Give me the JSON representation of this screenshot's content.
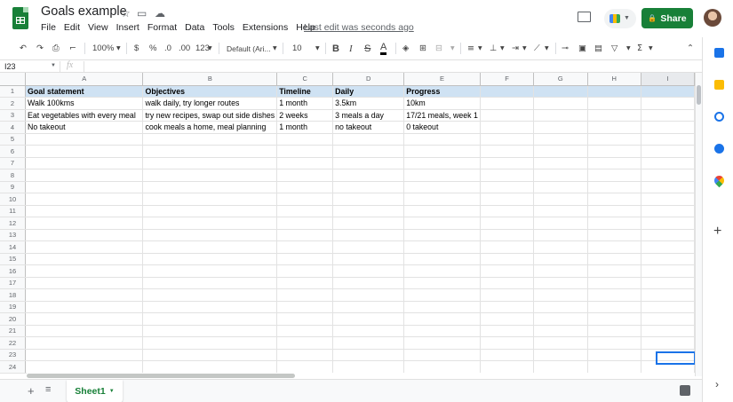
{
  "title": "Goals example",
  "menu": [
    "File",
    "Edit",
    "View",
    "Insert",
    "Format",
    "Data",
    "Tools",
    "Extensions",
    "Help"
  ],
  "last_edit": "Last edit was seconds ago",
  "share_label": "Share",
  "toolbar": {
    "zoom": "100%",
    "currency": "$",
    "percent": "%",
    "dec_decrease": ".0",
    "dec_increase": ".00",
    "more_formats": "123",
    "font": "Default (Ari...",
    "font_size": "10",
    "bold": "B",
    "italic": "I",
    "strike": "S",
    "text_color": "A"
  },
  "name_box": "I23",
  "fx": "fx",
  "columns": [
    "A",
    "B",
    "C",
    "D",
    "E",
    "F",
    "G",
    "H",
    "I"
  ],
  "rows": [
    [
      "Goal statement",
      "Objectives",
      "Timeline",
      "Daily",
      "Progress",
      "",
      "",
      "",
      ""
    ],
    [
      "Walk 100kms",
      "walk daily, try longer routes",
      "1 month",
      "3.5km",
      "10km",
      "",
      "",
      "",
      ""
    ],
    [
      "Eat vegetables with every meal",
      "try new recipes, swap out side dishes",
      "2 weeks",
      "3 meals a day",
      "17/21 meals, week 1",
      "",
      "",
      "",
      ""
    ],
    [
      "No takeout",
      "cook meals a home, meal planning",
      "1 month",
      "no takeout",
      "0 takeout",
      "",
      "",
      "",
      ""
    ]
  ],
  "row_count": 24,
  "sheet_tab": "Sheet1",
  "colors": {
    "brand": "#188038",
    "header_fill": "#cfe2f3",
    "selection": "#1a73e8"
  }
}
